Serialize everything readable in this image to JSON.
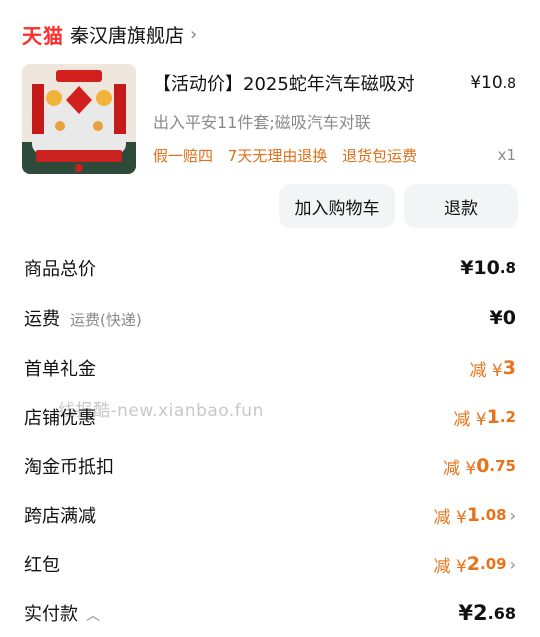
{
  "store": {
    "badge": "天猫",
    "name": "秦汉唐旗舰店",
    "chevron": "›"
  },
  "product": {
    "title": "【活动价】2025蛇年汽车磁吸对",
    "price_int": "¥10",
    "price_dec": ".8",
    "spec": "出入平安11件套;磁吸汽车对联",
    "services": [
      "假一赔四",
      "7天无理由退换",
      "退货包运费"
    ],
    "qty": "x1",
    "thumbnail_caption": "出入平安11件套"
  },
  "buttons": {
    "add_cart": "加入购物车",
    "refund": "退款"
  },
  "summary": {
    "goods_total": {
      "label": "商品总价",
      "int": "¥10",
      "dec": ".8"
    },
    "shipping": {
      "label": "运费",
      "sub": "运费(快递)",
      "value": "¥0"
    },
    "first_order": {
      "label": "首单礼金",
      "prefix": "减 ¥",
      "value": "3"
    },
    "shop_discount": {
      "label": "店铺优惠",
      "prefix": "减 ¥",
      "int": "1",
      "dec": ".2"
    },
    "taojinbi": {
      "label": "淘金币抵扣",
      "prefix": "减 ¥",
      "int": "0",
      "dec": ".75"
    },
    "cross_shop": {
      "label": "跨店满减",
      "prefix": "减 ¥",
      "int": "1",
      "dec": ".08"
    },
    "red_packet": {
      "label": "红包",
      "prefix": "减 ¥",
      "int": "2",
      "dec": ".09"
    },
    "paid": {
      "label": "实付款",
      "int": "¥2",
      "dec": ".68"
    }
  },
  "watermark": "线报酷-new.xianbao.fun",
  "colors": {
    "tmall_red": "#ff2c2c",
    "accent_orange": "#e8731a"
  }
}
